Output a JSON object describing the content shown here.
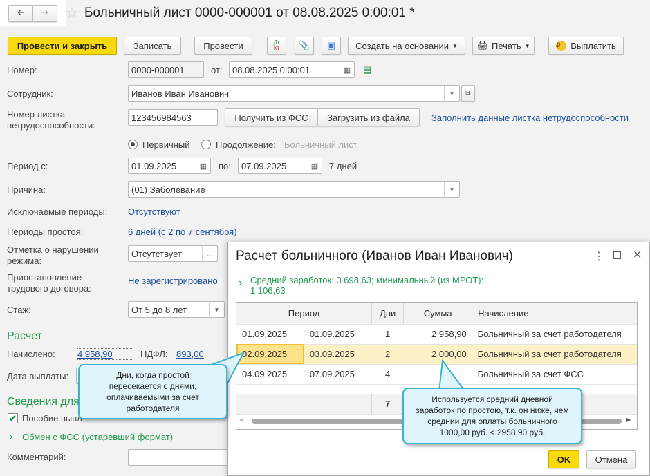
{
  "window": {
    "title": "Больничный лист 0000-000001 от 08.08.2025 0:00:01 *"
  },
  "toolbar": {
    "post_close": "Провести и закрыть",
    "save": "Записать",
    "post": "Провести",
    "dtkt_dt": "Дт",
    "dtkt_kt": "Кт",
    "create_based": "Создать на основании",
    "print": "Печать",
    "pay": "Выплатить"
  },
  "form": {
    "number_label": "Номер:",
    "number": "0000-000001",
    "from_label": "от:",
    "date": "08.08.2025  0:00:01",
    "employee_label": "Сотрудник:",
    "employee": "Иванов Иван Иванович",
    "sheet_label": "Номер листка нетрудоспособности:",
    "sheet_number": "123456984563",
    "get_fss": "Получить из ФСС",
    "load_file": "Загрузить из файла",
    "fill_link": "Заполнить данные листка нетрудоспособности",
    "primary": "Первичный",
    "continuation": "Продолжение:",
    "sick_link": "Больничный лист",
    "period_label": "Период с:",
    "period_from": "01.09.2025",
    "to_label": "по:",
    "period_to": "07.09.2025",
    "days": "7 дней",
    "reason_label": "Причина:",
    "reason": "(01) Заболевание",
    "excluded_label": "Исключаемые периоды:",
    "excluded": "Отсутствуют",
    "idle_label": "Периоды простоя:",
    "idle": "6 дней (с 2 по 7 сентября)",
    "violation_label": "Отметка о нарушении режима:",
    "violation": "Отсутствует",
    "suspension_label": "Приостановление трудового договора:",
    "suspension": "Не зарегистрировано",
    "exp_label": "Стаж:",
    "exp": "От 5 до 8 лет",
    "calc_header": "Расчет",
    "accrued_label": "Начислено:",
    "accrued": "4 958,90",
    "ndfl_label": "НДФЛ:",
    "ndfl": "893,00",
    "paydate_label": "Дата выплаты:",
    "info_header": "Сведения для",
    "benefit": "Пособие выпл",
    "exchange": "Обмен с ФСС (устаревший формат)",
    "comment_label": "Комментарий:"
  },
  "dialog": {
    "title": "Расчет больничного (Иванов Иван Иванович)",
    "avg": "Средний заработок: 3 698,63; минимальный (из МРОТ):",
    "avg2": "1 106,63",
    "columns": [
      "Период",
      "Дни",
      "Сумма",
      "Начисление"
    ],
    "rows": [
      {
        "from": "01.09.2025",
        "to": "01.09.2025",
        "days": "1",
        "sum": "2 958,90",
        "type": "Больничный за счет работодателя"
      },
      {
        "from": "02.09.2025",
        "to": "03.09.2025",
        "days": "2",
        "sum": "2 000,00",
        "type": "Больничный за счет работодателя"
      },
      {
        "from": "04.09.2025",
        "to": "07.09.2025",
        "days": "4",
        "sum": "",
        "type": "Больничный за счет ФСС"
      }
    ],
    "total_days": "7",
    "ok": "OK",
    "cancel": "Отмена"
  },
  "callouts": {
    "left": "Дни, когда простой пересекается с днями, оплачиваемыми за счет работодателя",
    "right": "Используется средний дневной заработок по простою, т.к. он ниже, чем средний для оплаты больничного 1000,00 руб. <  2958,90 руб."
  },
  "colors": {
    "accent": "#f7d90c",
    "green": "#1f9a4e",
    "link": "#1a4f9c",
    "callout": "#dff5fb",
    "selected_row": "#fdf1c5"
  }
}
